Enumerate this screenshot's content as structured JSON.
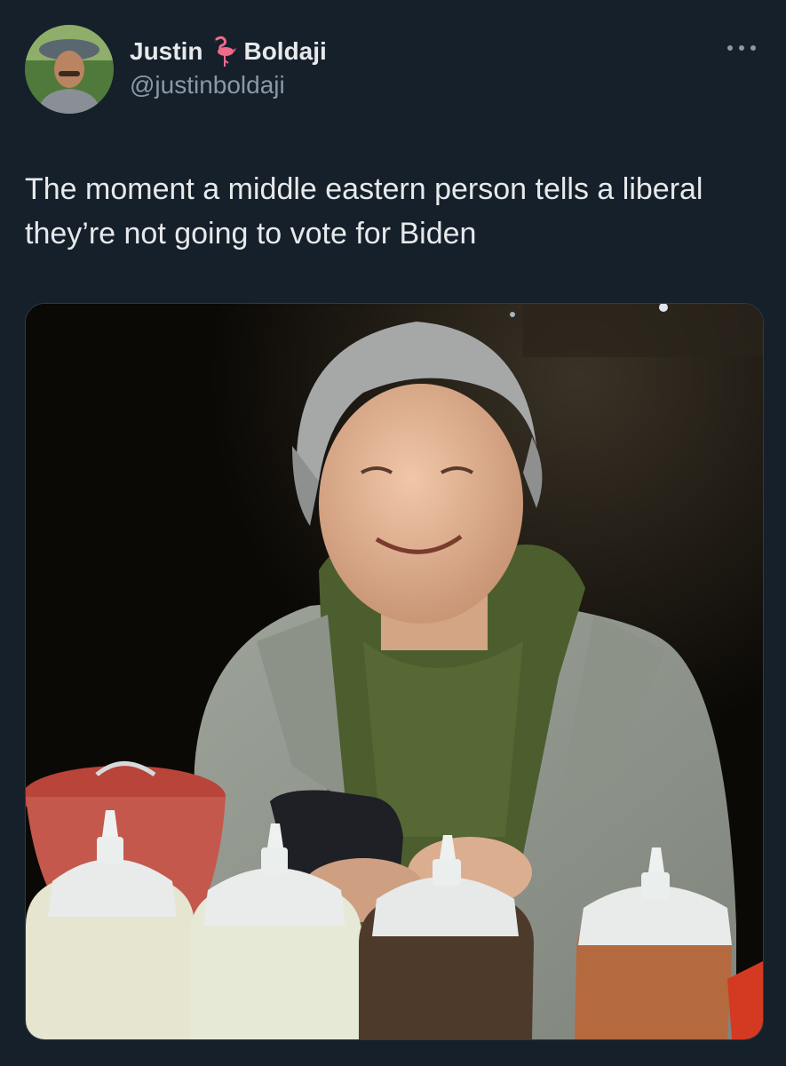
{
  "tweet": {
    "author": {
      "first_name": "Justin",
      "last_name": "Boldaji",
      "name_emoji": "flamingo-icon",
      "handle": "@justinboldaji"
    },
    "text": "The moment a middle eastern person tells a liberal they’re not going to vote for Biden",
    "more_icon": "more-options-icon"
  },
  "colors": {
    "background": "#15202b",
    "primary_text": "#e7e9ea",
    "secondary_text": "#8b98a5"
  }
}
